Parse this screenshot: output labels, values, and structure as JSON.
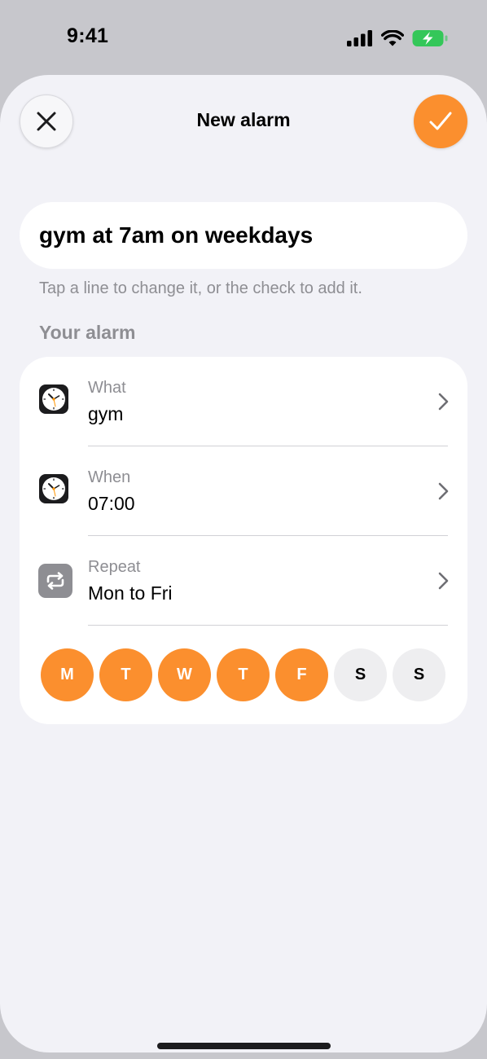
{
  "status_bar": {
    "time": "9:41",
    "icons": [
      "cellular-signal-icon",
      "wifi-icon",
      "battery-charging-icon"
    ],
    "battery_color": "#34c759"
  },
  "header": {
    "title": "New alarm",
    "close_icon": "close-icon",
    "confirm_icon": "checkmark-icon"
  },
  "query": {
    "value": "gym at 7am on weekdays"
  },
  "hint": "Tap a line to change it, or the check to add it.",
  "section_label": "Your alarm",
  "rows": [
    {
      "label": "What",
      "value": "gym",
      "icon": "clock-icon"
    },
    {
      "label": "When",
      "value": "07:00",
      "icon": "clock-icon"
    },
    {
      "label": "Repeat",
      "value": "Mon to Fri",
      "icon": "repeat-icon"
    }
  ],
  "days": [
    {
      "letter": "M",
      "selected": true
    },
    {
      "letter": "T",
      "selected": true
    },
    {
      "letter": "W",
      "selected": true
    },
    {
      "letter": "T",
      "selected": true
    },
    {
      "letter": "F",
      "selected": true
    },
    {
      "letter": "S",
      "selected": false
    },
    {
      "letter": "S",
      "selected": false
    }
  ],
  "colors": {
    "accent": "#fb8f2e",
    "sheet_background": "#f2f2f7",
    "secondary_text": "#8e8e93"
  }
}
